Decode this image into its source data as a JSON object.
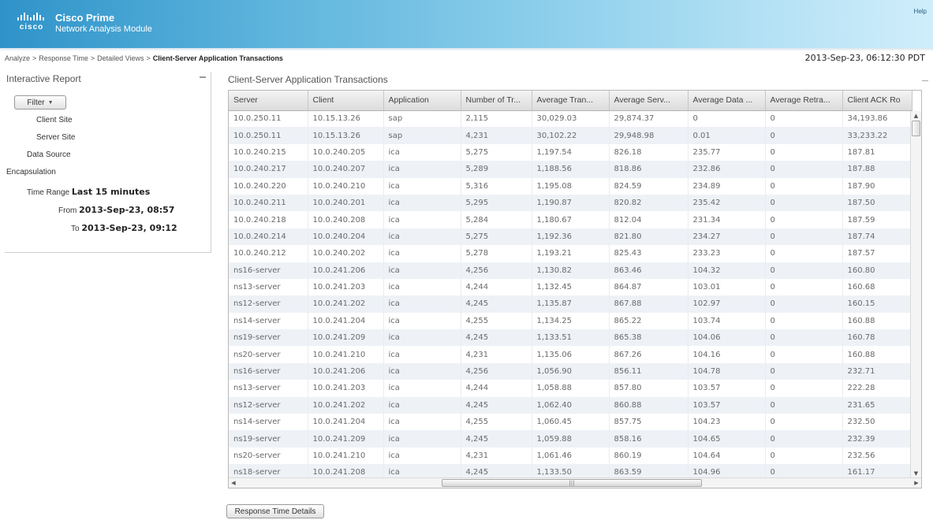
{
  "header": {
    "logo_text": "cisco",
    "product": "Cisco Prime",
    "module": "Network Analysis Module",
    "help": "Help"
  },
  "breadcrumb": {
    "items": [
      "Analyze",
      "Response Time",
      "Detailed Views"
    ],
    "current": "Client-Server Application Transactions"
  },
  "timestamp": "2013-Sep-23, 06:12:30 PDT",
  "left_panel": {
    "title": "Interactive Report",
    "filter_button": "Filter",
    "client_site": "Client Site",
    "server_site": "Server Site",
    "data_source": "Data Source",
    "encapsulation": "Encapsulation",
    "time_range_label": "Time Range",
    "time_range_value": "Last 15 minutes",
    "from_label": "From",
    "from_value": "2013-Sep-23, 08:57",
    "to_label": "To",
    "to_value": "2013-Sep-23, 09:12"
  },
  "report": {
    "title": "Client-Server Application Transactions",
    "columns": [
      "Server",
      "Client",
      "Application",
      "Number of Tr...",
      "Average Tran...",
      "Average Serv...",
      "Average Data ...",
      "Average Retra...",
      "Client ACK Ro"
    ],
    "rows": [
      [
        "10.0.250.11",
        "10.15.13.26",
        "sap",
        "2,115",
        "30,029.03",
        "29,874.37",
        "0",
        "0",
        "34,193.86"
      ],
      [
        "10.0.250.11",
        "10.15.13.26",
        "sap",
        "4,231",
        "30,102.22",
        "29,948.98",
        "0.01",
        "0",
        "33,233.22"
      ],
      [
        "10.0.240.215",
        "10.0.240.205",
        "ica",
        "5,275",
        "1,197.54",
        "826.18",
        "235.77",
        "0",
        "187.81"
      ],
      [
        "10.0.240.217",
        "10.0.240.207",
        "ica",
        "5,289",
        "1,188.56",
        "818.86",
        "232.86",
        "0",
        "187.88"
      ],
      [
        "10.0.240.220",
        "10.0.240.210",
        "ica",
        "5,316",
        "1,195.08",
        "824.59",
        "234.89",
        "0",
        "187.90"
      ],
      [
        "10.0.240.211",
        "10.0.240.201",
        "ica",
        "5,295",
        "1,190.87",
        "820.82",
        "235.42",
        "0",
        "187.50"
      ],
      [
        "10.0.240.218",
        "10.0.240.208",
        "ica",
        "5,284",
        "1,180.67",
        "812.04",
        "231.34",
        "0",
        "187.59"
      ],
      [
        "10.0.240.214",
        "10.0.240.204",
        "ica",
        "5,275",
        "1,192.36",
        "821.80",
        "234.27",
        "0",
        "187.74"
      ],
      [
        "10.0.240.212",
        "10.0.240.202",
        "ica",
        "5,278",
        "1,193.21",
        "825.43",
        "233.23",
        "0",
        "187.57"
      ],
      [
        "ns16-server",
        "10.0.241.206",
        "ica",
        "4,256",
        "1,130.82",
        "863.46",
        "104.32",
        "0",
        "160.80"
      ],
      [
        "ns13-server",
        "10.0.241.203",
        "ica",
        "4,244",
        "1,132.45",
        "864.87",
        "103.01",
        "0",
        "160.68"
      ],
      [
        "ns12-server",
        "10.0.241.202",
        "ica",
        "4,245",
        "1,135.87",
        "867.88",
        "102.97",
        "0",
        "160.15"
      ],
      [
        "ns14-server",
        "10.0.241.204",
        "ica",
        "4,255",
        "1,134.25",
        "865.22",
        "103.74",
        "0",
        "160.88"
      ],
      [
        "ns19-server",
        "10.0.241.209",
        "ica",
        "4,245",
        "1,133.51",
        "865.38",
        "104.06",
        "0",
        "160.78"
      ],
      [
        "ns20-server",
        "10.0.241.210",
        "ica",
        "4,231",
        "1,135.06",
        "867.26",
        "104.16",
        "0",
        "160.88"
      ],
      [
        "ns16-server",
        "10.0.241.206",
        "ica",
        "4,256",
        "1,056.90",
        "856.11",
        "104.78",
        "0",
        "232.71"
      ],
      [
        "ns13-server",
        "10.0.241.203",
        "ica",
        "4,244",
        "1,058.88",
        "857.80",
        "103.57",
        "0",
        "222.28"
      ],
      [
        "ns12-server",
        "10.0.241.202",
        "ica",
        "4,245",
        "1,062.40",
        "860.88",
        "103.57",
        "0",
        "231.65"
      ],
      [
        "ns14-server",
        "10.0.241.204",
        "ica",
        "4,255",
        "1,060.45",
        "857.75",
        "104.23",
        "0",
        "232.50"
      ],
      [
        "ns19-server",
        "10.0.241.209",
        "ica",
        "4,245",
        "1,059.88",
        "858.16",
        "104.65",
        "0",
        "232.39"
      ],
      [
        "ns20-server",
        "10.0.241.210",
        "ica",
        "4,231",
        "1,061.46",
        "860.19",
        "104.64",
        "0",
        "232.56"
      ],
      [
        "ns18-server",
        "10.0.241.208",
        "ica",
        "4,245",
        "1,133.50",
        "863.59",
        "104.96",
        "0",
        "161.17"
      ]
    ]
  },
  "details_button": "Response Time Details"
}
